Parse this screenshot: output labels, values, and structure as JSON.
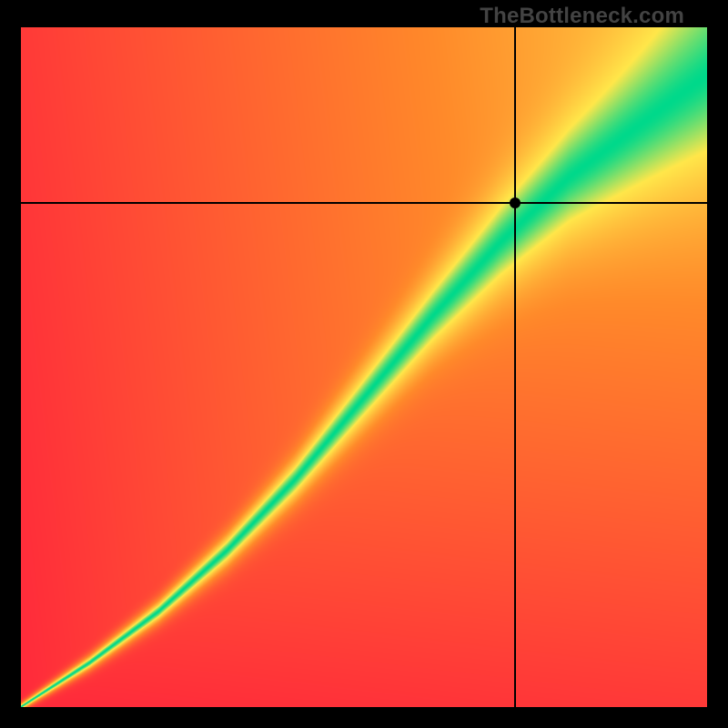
{
  "watermark": "TheBottleneck.com",
  "crosshair": {
    "x_frac": 0.72,
    "y_frac": 0.258,
    "dot_radius_px": 6
  },
  "color_stops": {
    "red": "#ff2a3b",
    "orange": "#ff8a2a",
    "yellow": "#ffe74a",
    "green": "#00d98b"
  },
  "chart_data": {
    "type": "heatmap",
    "title": "",
    "xlabel": "",
    "ylabel": "",
    "xlim": [
      0,
      1
    ],
    "ylim": [
      0,
      1
    ],
    "note": "x and y are normalized; value = match quality (1 = ideal balance, 0 = severe bottleneck). Green ridge marks ideal pairing; crosshair marks the selected CPU/GPU pair.",
    "ridge": [
      {
        "x": 0.0,
        "y": 0.0
      },
      {
        "x": 0.1,
        "y": 0.065
      },
      {
        "x": 0.2,
        "y": 0.14
      },
      {
        "x": 0.3,
        "y": 0.23
      },
      {
        "x": 0.4,
        "y": 0.335
      },
      {
        "x": 0.5,
        "y": 0.455
      },
      {
        "x": 0.6,
        "y": 0.575
      },
      {
        "x": 0.7,
        "y": 0.685
      },
      {
        "x": 0.8,
        "y": 0.78
      },
      {
        "x": 0.9,
        "y": 0.855
      },
      {
        "x": 1.0,
        "y": 0.93
      }
    ],
    "ridge_width": [
      {
        "x": 0.0,
        "w": 0.006
      },
      {
        "x": 0.2,
        "w": 0.018
      },
      {
        "x": 0.4,
        "w": 0.035
      },
      {
        "x": 0.6,
        "w": 0.06
      },
      {
        "x": 0.8,
        "w": 0.095
      },
      {
        "x": 1.0,
        "w": 0.14
      }
    ],
    "selected_point": {
      "x": 0.72,
      "y": 0.742
    },
    "colormap": [
      {
        "value": 0.0,
        "color": "#ff2a3b"
      },
      {
        "value": 0.45,
        "color": "#ff8a2a"
      },
      {
        "value": 0.78,
        "color": "#ffe74a"
      },
      {
        "value": 1.0,
        "color": "#00d98b"
      }
    ]
  }
}
